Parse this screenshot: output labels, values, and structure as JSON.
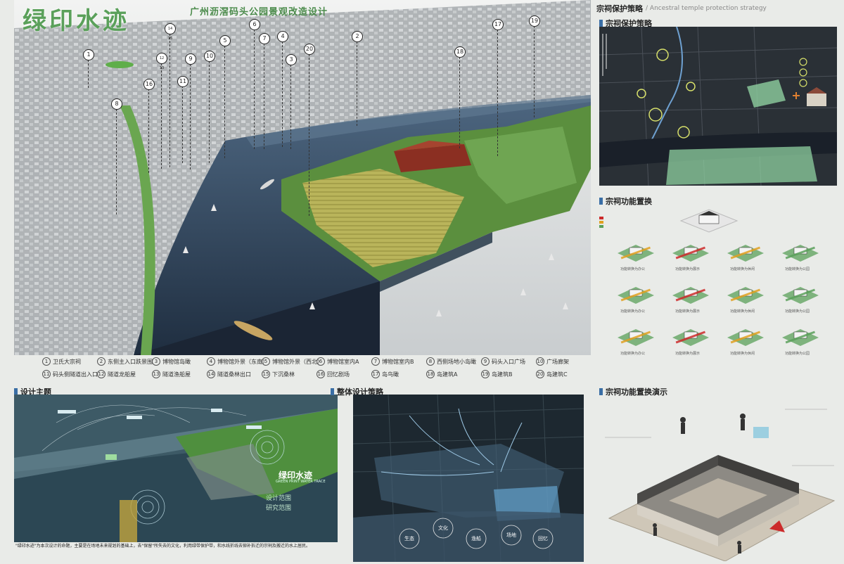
{
  "header": {
    "logo_text": "绿印水迹",
    "subtitle": "广州沥滘码头公园景观改造设计"
  },
  "legend": {
    "row1": [
      {
        "n": "1",
        "label": "卫氏大宗祠"
      },
      {
        "n": "2",
        "label": "东侧主入口跌景围"
      },
      {
        "n": "3",
        "label": "博物馆岛瞰"
      },
      {
        "n": "4",
        "label": "博物馆外景（东南）"
      },
      {
        "n": "5",
        "label": "博物馆外景（西北）"
      },
      {
        "n": "6",
        "label": "博物馆室内A"
      },
      {
        "n": "7",
        "label": "博物馆室内B"
      },
      {
        "n": "8",
        "label": "西侧场地小岛瞰"
      },
      {
        "n": "9",
        "label": "码头入口广场"
      },
      {
        "n": "10",
        "label": "广场廊架"
      }
    ],
    "row2": [
      {
        "n": "11",
        "label": "码头侧隧道出入口"
      },
      {
        "n": "12",
        "label": "隧道龙船屋"
      },
      {
        "n": "13",
        "label": "隧道渔船屋"
      },
      {
        "n": "14",
        "label": "隧道桑林出口"
      },
      {
        "n": "15",
        "label": "下沉桑林"
      },
      {
        "n": "16",
        "label": "回忆剧场"
      },
      {
        "n": "17",
        "label": "岛鸟瞰"
      },
      {
        "n": "18",
        "label": "岛建筑A"
      },
      {
        "n": "19",
        "label": "岛建筑B"
      },
      {
        "n": "20",
        "label": "岛建筑C"
      }
    ]
  },
  "callouts": [
    "1",
    "8",
    "16",
    "11",
    "14 15",
    "12 13",
    "9",
    "10",
    "5",
    "6",
    "7",
    "4",
    "3",
    "20",
    "2",
    "18",
    "17",
    "19"
  ],
  "sections": {
    "ancestral_title": "宗祠保护策略",
    "ancestral_en": "Ancestral temple protection strategy",
    "ancestral_sub": "宗祠保护策略",
    "function_title": "宗祠功能置换",
    "demo_title": "宗祠功能置换演示",
    "theme_title": "设计主题",
    "strategy_title": "整体设计策略"
  },
  "theme_panel": {
    "brand": "绿印水迹",
    "brand_en": "GREEN PRINT WATER TRACE",
    "scope_a": "设计范围",
    "scope_b": "研究范围",
    "bottom_text": "\"绿印水迹\"为本次设计的命题，主要是在场地未来规划的基础上，去\"保留\"所失去的文化，利用绿带保护带，和水线折线去铆补拆迁的宗祠及搬迁的水上居民。"
  },
  "strategy_nodes": [
    "生态",
    "文化",
    "渔船",
    "场地",
    "回忆"
  ],
  "function_labels": [
    "功能转换为办公",
    "功能转换为展示",
    "功能转换为休闲",
    "功能转换为公园"
  ],
  "colors": {
    "accent_green": "#5aa05a",
    "section_blue": "#3a6ea5",
    "water": "#1e2a3a",
    "highlight_red": "#cc2a2a"
  }
}
